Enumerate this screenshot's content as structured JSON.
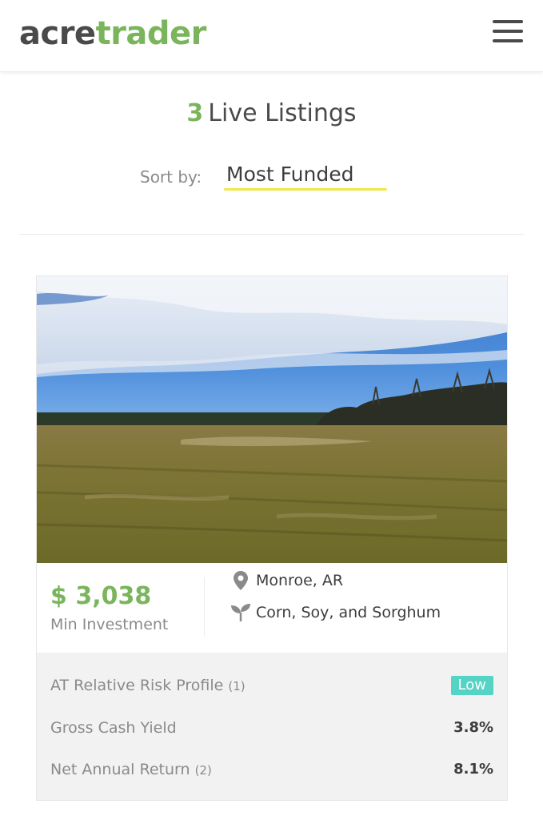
{
  "header": {
    "logo_part1": "acre",
    "logo_part2": "trader",
    "menu_icon": "hamburger-menu-icon"
  },
  "listings": {
    "count": "3",
    "title": "Live Listings"
  },
  "sort": {
    "label": "Sort by:",
    "value": "Most Funded"
  },
  "card": {
    "image_alt": "Farmland field under blue sky",
    "min_investment": "$ 3,038",
    "min_investment_label": "Min Investment",
    "location": "Monroe, AR",
    "location_icon": "map-pin-icon",
    "crops": "Corn, Soy, and Sorghum",
    "crops_icon": "sprout-icon",
    "stats": [
      {
        "label": "AT Relative Risk Profile",
        "note": "(1)",
        "value": "Low"
      },
      {
        "label": "Gross Cash Yield",
        "note": "",
        "value": "3.8%"
      },
      {
        "label": "Net Annual Return",
        "note": "(2)",
        "value": "8.1%"
      }
    ]
  },
  "colors": {
    "brand_green": "#7ab55c",
    "sort_underline": "#f1e64a",
    "risk_badge": "#55d3c4"
  }
}
